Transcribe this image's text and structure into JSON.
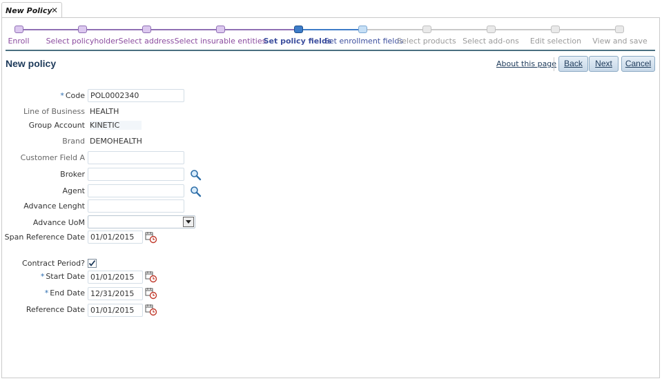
{
  "tab": {
    "label": "New Policy",
    "close": "✕"
  },
  "train": {
    "stops": [
      {
        "label": "Enroll",
        "state": "visited"
      },
      {
        "label": "Select policyholder",
        "state": "visited"
      },
      {
        "label": "Select address",
        "state": "visited"
      },
      {
        "label": "Select insurable entities",
        "state": "visited"
      },
      {
        "label": "Set policy fields",
        "state": "current"
      },
      {
        "label": "Set enrollment fields",
        "state": "next"
      },
      {
        "label": "Select products",
        "state": "future"
      },
      {
        "label": "Select add-ons",
        "state": "future"
      },
      {
        "label": "Edit selection",
        "state": "future"
      },
      {
        "label": "View and save",
        "state": "future"
      }
    ]
  },
  "header": {
    "title": "New policy",
    "about_link": "About this page",
    "back": "Back",
    "next": "Next",
    "cancel": "Cancel"
  },
  "form": {
    "code": {
      "label": "Code",
      "required": "*",
      "value": "POL0002340"
    },
    "line_of_business": {
      "label": "Line of Business",
      "value": "HEALTH"
    },
    "group_account": {
      "label": "Group Account",
      "value": "KINETIC"
    },
    "brand": {
      "label": "Brand",
      "value": "DEMOHEALTH"
    },
    "customer_field_a": {
      "label": "Customer Field A",
      "value": ""
    },
    "broker": {
      "label": "Broker",
      "value": ""
    },
    "agent": {
      "label": "Agent",
      "value": ""
    },
    "advance_length": {
      "label": "Advance Lenght",
      "value": ""
    },
    "advance_uom": {
      "label": "Advance UoM",
      "value": ""
    },
    "span_reference_date": {
      "label": "Span Reference Date",
      "value": "01/01/2015"
    },
    "contract_period": {
      "label": "Contract Period?",
      "checked": true
    },
    "start_date": {
      "label": "Start Date",
      "required": "*",
      "value": "01/01/2015"
    },
    "end_date": {
      "label": "End Date",
      "required": "*",
      "value": "12/31/2015"
    },
    "reference_date": {
      "label": "Reference Date",
      "value": "01/01/2015"
    }
  },
  "colors": {
    "title": "#1d3a5a",
    "visited": "#8a4a9e",
    "current": "#3d4f9e",
    "required": "#2b6cb0"
  },
  "icons": [
    "close-icon",
    "search-icon",
    "calendar-icon",
    "chevron-down-icon",
    "checkmark-icon"
  ]
}
